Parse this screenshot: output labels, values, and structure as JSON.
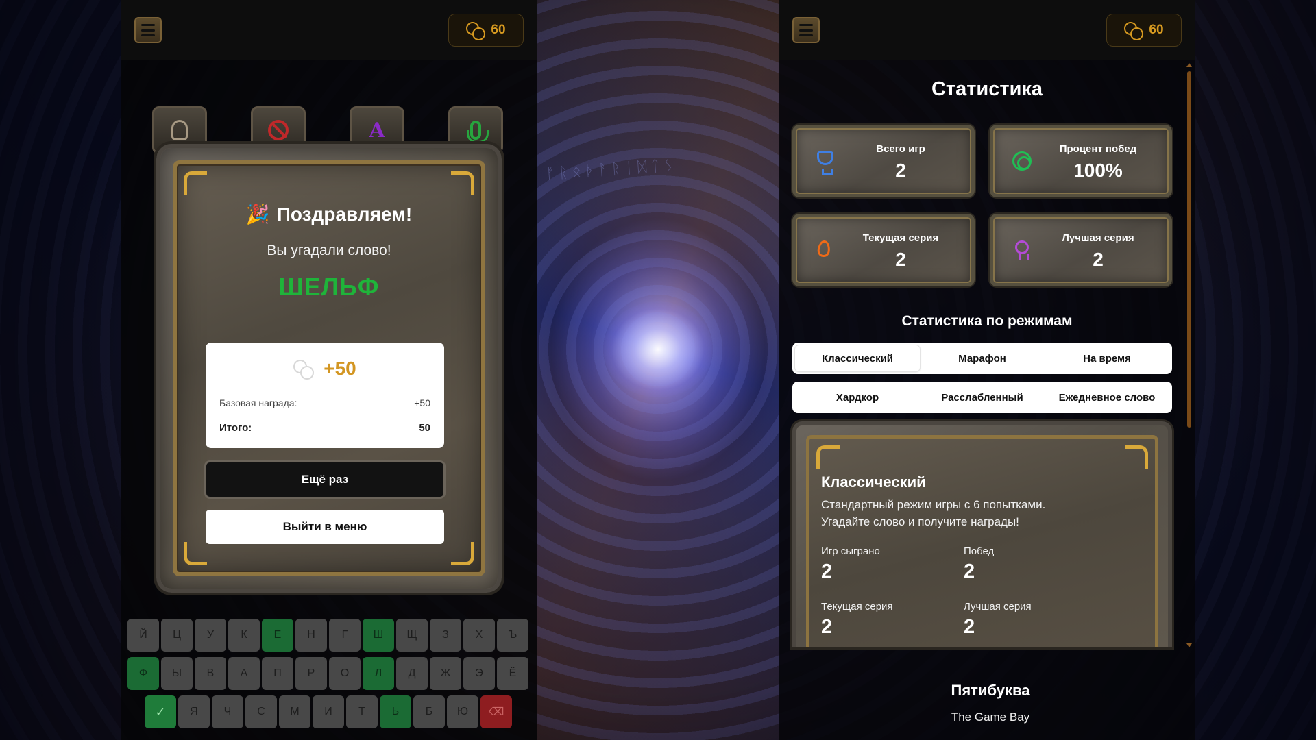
{
  "coins": "60",
  "left": {
    "powerups": [
      "lightbulb-hint",
      "no-entry",
      "letter-A",
      "microphone"
    ],
    "powerup_letter": "A",
    "modal": {
      "emoji": "🎉",
      "title": "Поздравляем!",
      "subtitle": "Вы угадали слово!",
      "word": "ШЕЛЬФ",
      "reward_amount": "+50",
      "base_label": "Базовая награда:",
      "base_value": "+50",
      "total_label": "Итого:",
      "total_value": "50",
      "again_button": "Ещё раз",
      "menu_button": "Выйти в меню"
    },
    "keyboard": {
      "row1": [
        "Й",
        "Ц",
        "У",
        "К",
        "Е",
        "Н",
        "Г",
        "Ш",
        "Щ",
        "З",
        "Х",
        "Ъ"
      ],
      "row2": [
        "Ф",
        "Ы",
        "В",
        "А",
        "П",
        "Р",
        "О",
        "Л",
        "Д",
        "Ж",
        "Э",
        "Ё"
      ],
      "row3": [
        "✓",
        "Я",
        "Ч",
        "С",
        "М",
        "И",
        "Т",
        "Ь",
        "Б",
        "Ю",
        "⌫"
      ],
      "green_keys": [
        "Е",
        "Ш",
        "Ф",
        "Л",
        "Ь"
      ]
    }
  },
  "center": {
    "runes": "ᚠᚱᛟᚦᚨᚱᛁᛞᛏᛊ"
  },
  "right": {
    "title": "Статистика",
    "cards": [
      {
        "label": "Всего игр",
        "value": "2",
        "icon": "trophy-icon",
        "color": "#3f7fe3"
      },
      {
        "label": "Процент побед",
        "value": "100%",
        "icon": "target-icon",
        "color": "#1fbf54"
      },
      {
        "label": "Текущая серия",
        "value": "2",
        "icon": "flame-icon",
        "color": "#f06a17"
      },
      {
        "label": "Лучшая серия",
        "value": "2",
        "icon": "ribbon-icon",
        "color": "#b34bd6"
      }
    ],
    "modes_title": "Статистика по режимам",
    "tabs_row1": [
      "Классический",
      "Марафон",
      "На время"
    ],
    "tabs_row2": [
      "Хардкор",
      "Расслабленный",
      "Ежедневное слово"
    ],
    "active_tab": "Классический",
    "mode": {
      "name": "Классический",
      "description": "Стандартный режим игры с 6 попытками. Угадайте слово и получите награды!",
      "played_label": "Игр сыграно",
      "played_value": "2",
      "wins_label": "Побед",
      "wins_value": "2",
      "current_label": "Текущая серия",
      "current_value": "2",
      "best_label": "Лучшая серия",
      "best_value": "2"
    },
    "footer_title": "Пятибуква",
    "footer_sub": "The Game Bay"
  }
}
